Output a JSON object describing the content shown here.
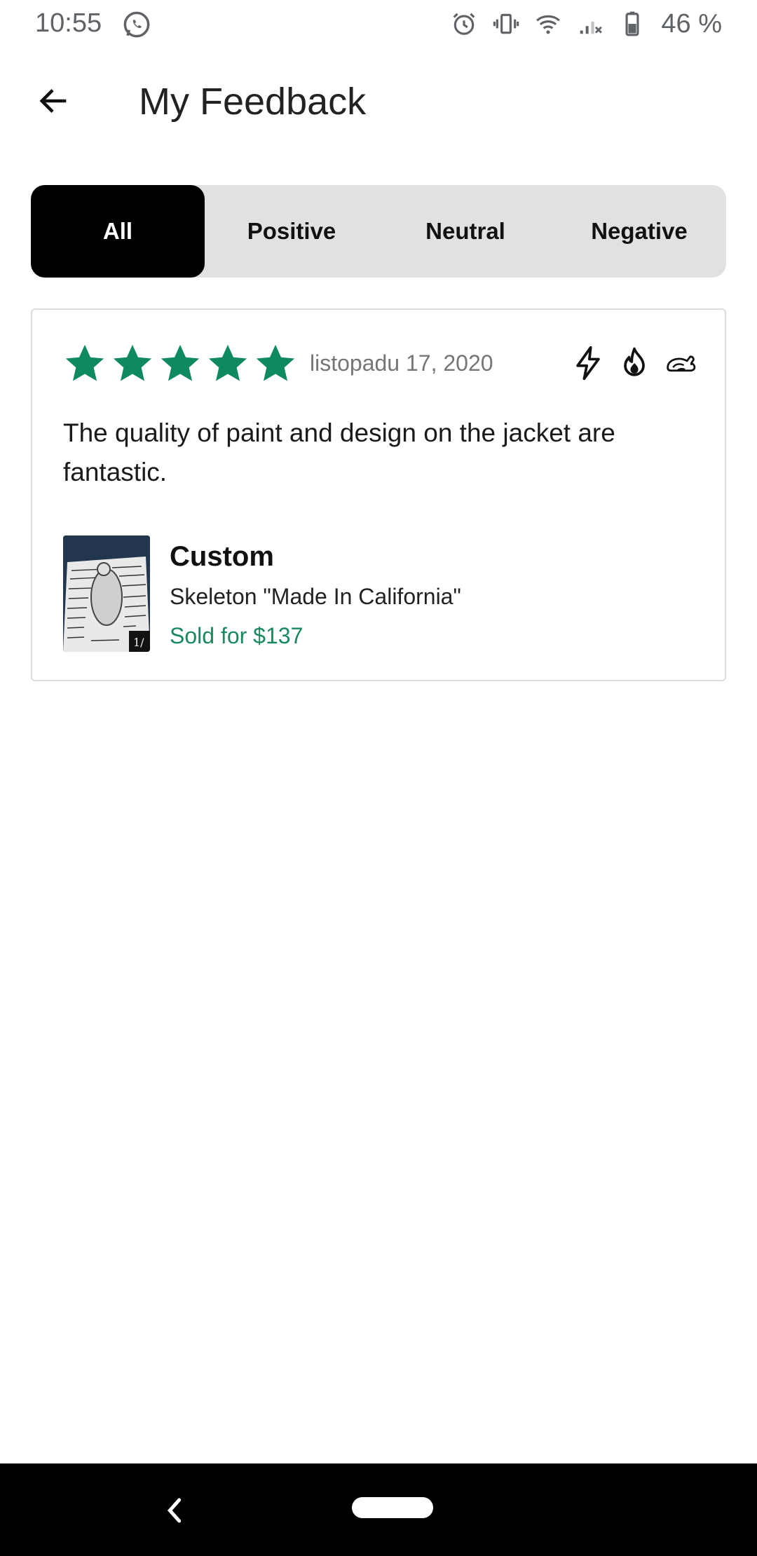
{
  "status_bar": {
    "time": "10:55",
    "left_icons": [
      "whatsapp-icon"
    ],
    "right_icons": [
      "alarm-icon",
      "vibrate-icon",
      "wifi-icon",
      "signal-icon",
      "battery-icon"
    ],
    "battery_text": "46 %",
    "battery_level": 0.46
  },
  "header": {
    "back_icon": "arrow-left-icon",
    "title": "My Feedback"
  },
  "tabs": [
    {
      "label": "All",
      "active": true
    },
    {
      "label": "Positive",
      "active": false
    },
    {
      "label": "Neutral",
      "active": false
    },
    {
      "label": "Negative",
      "active": false
    }
  ],
  "feedback": [
    {
      "rating": 5,
      "rating_max": 5,
      "date": "listopadu 17, 2020",
      "badges": [
        "lightning-icon",
        "flame-icon",
        "rabbit-icon"
      ],
      "text": "The quality of paint and design on the jacket are fantastic.",
      "item": {
        "brand": "Custom",
        "name": "Skeleton \"Made In California\"",
        "price_text": "Sold for $137"
      }
    }
  ],
  "colors": {
    "accent_green": "#0f8a5f",
    "price_green": "#1a8a5e",
    "tab_active_bg": "#000000",
    "tab_bar_bg": "#e1e1e1"
  },
  "nav_bar": {
    "back_icon": "chevron-left-icon",
    "home_icon": "home-pill-icon"
  }
}
